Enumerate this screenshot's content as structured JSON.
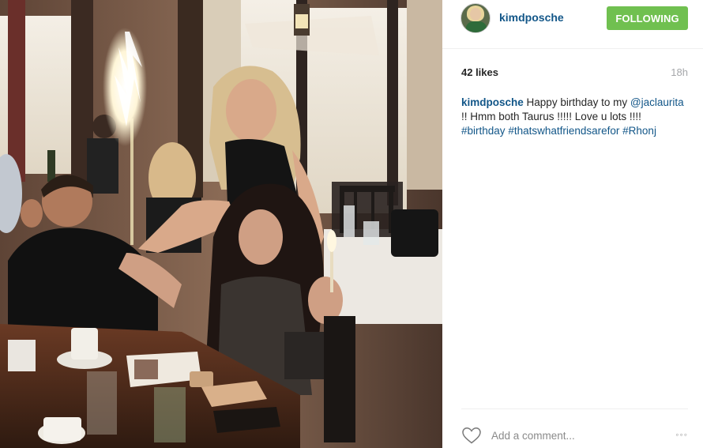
{
  "post": {
    "username": "kimdposche",
    "follow_label": "FOLLOWING",
    "likes": "42 likes",
    "time_ago": "18h",
    "caption": {
      "user": "kimdposche",
      "text_1": "Happy birthday to my",
      "mention": "@jaclaurita",
      "text_2": "!! Hmm both Taurus !!!!! Love u lots !!!!",
      "tag_1": "#birthday",
      "tag_2": "#thatswhatfriendsarefor",
      "tag_3": "#Rhonj"
    },
    "comment_placeholder": "Add a comment...",
    "more_label": "◦◦◦"
  },
  "colors": {
    "follow_bg": "#70c050",
    "link": "#125688",
    "muted": "#a5a7aa"
  },
  "icons": {
    "heart": "heart-outline-icon",
    "more": "more-options-icon"
  }
}
